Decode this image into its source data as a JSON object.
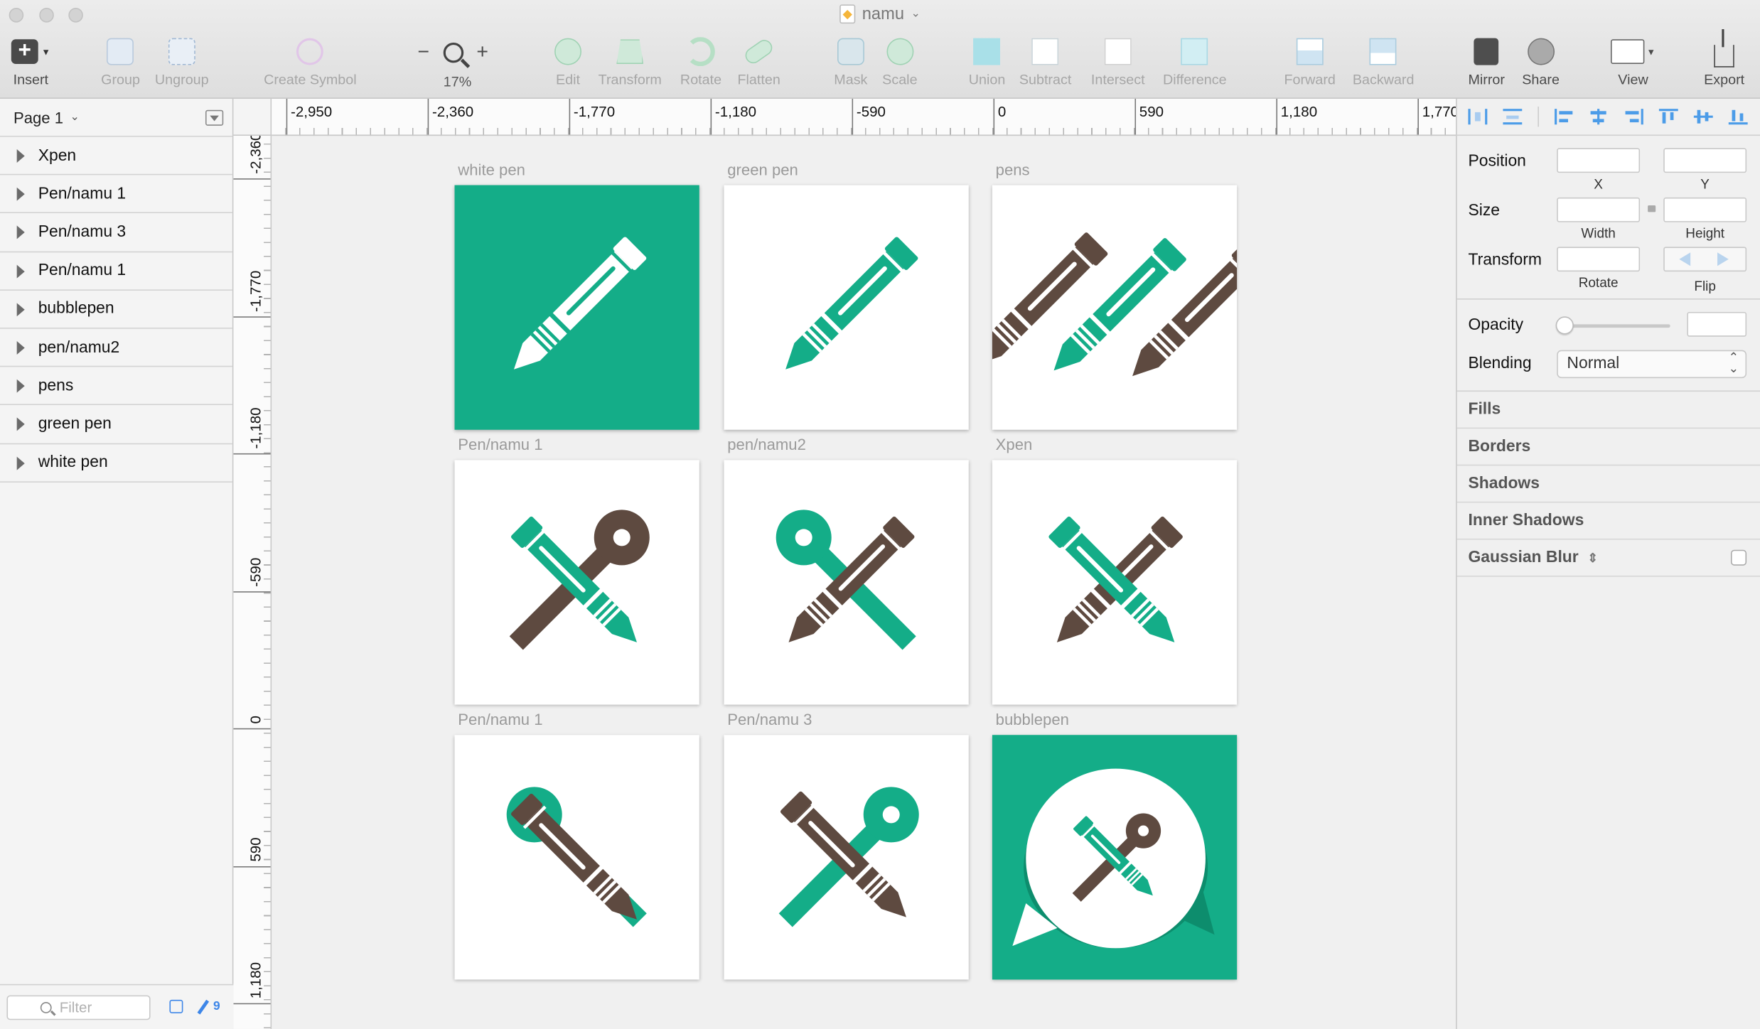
{
  "window": {
    "title": "namu"
  },
  "toolbar": {
    "insert": "Insert",
    "group": "Group",
    "ungroup": "Ungroup",
    "create_symbol": "Create Symbol",
    "zoom_minus": "−",
    "zoom_plus": "+",
    "zoom_level": "17%",
    "edit": "Edit",
    "transform": "Transform",
    "rotate": "Rotate",
    "flatten": "Flatten",
    "mask": "Mask",
    "scale": "Scale",
    "union": "Union",
    "subtract": "Subtract",
    "intersect": "Intersect",
    "difference": "Difference",
    "forward": "Forward",
    "backward": "Backward",
    "mirror": "Mirror",
    "share": "Share",
    "view": "View",
    "export": "Export"
  },
  "sidebar": {
    "page": "Page 1",
    "layers": [
      "Xpen",
      "Pen/namu 1",
      "Pen/namu 3",
      "Pen/namu 1",
      "bubblepen",
      "pen/namu2",
      "pens",
      "green pen",
      "white pen"
    ],
    "filter_placeholder": "Filter",
    "count": "9"
  },
  "rulers": {
    "horizontal": [
      "-2,950",
      "-2,360",
      "-1,770",
      "-1,180",
      "-590",
      "0",
      "590",
      "1,180",
      "1,770"
    ],
    "vertical": [
      "-2,360",
      "-1,770",
      "-1,180",
      "-590",
      "0",
      "590",
      "1,180"
    ]
  },
  "artboards": [
    {
      "label": "white pen",
      "icon": "white-pen-on-green"
    },
    {
      "label": "green pen",
      "icon": "green-pen"
    },
    {
      "label": "pens",
      "icon": "three-pens"
    },
    {
      "label": "Pen/namu 1",
      "icon": "crossed-pen-pin"
    },
    {
      "label": "pen/namu2",
      "icon": "crossed-pen-pin-brown"
    },
    {
      "label": "Xpen",
      "icon": "crossed-pens"
    },
    {
      "label": "Pen/namu 1",
      "icon": "brown-pin-pen"
    },
    {
      "label": "Pen/namu 3",
      "icon": "brown-pen-green-pin"
    },
    {
      "label": "bubblepen",
      "icon": "speech-bubble-pen"
    }
  ],
  "inspector": {
    "position": "Position",
    "x": "X",
    "y": "Y",
    "size": "Size",
    "width": "Width",
    "height": "Height",
    "transform": "Transform",
    "rotate": "Rotate",
    "flip": "Flip",
    "opacity": "Opacity",
    "blending": "Blending",
    "blending_value": "Normal",
    "sections": [
      "Fills",
      "Borders",
      "Shadows",
      "Inner Shadows",
      "Gaussian Blur"
    ]
  },
  "colors": {
    "green": "#14ad88",
    "brown": "#5e4a40",
    "accent": "#4c9ce8"
  }
}
